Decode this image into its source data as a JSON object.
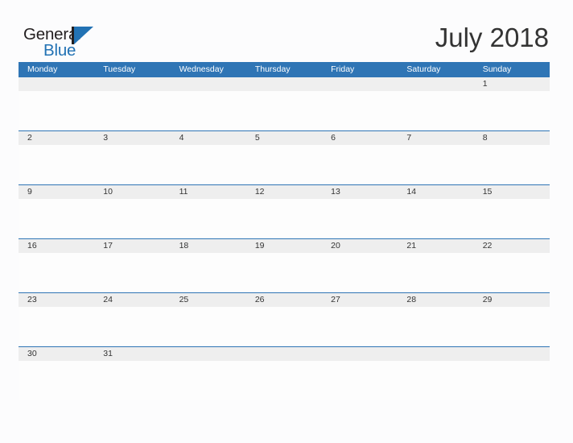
{
  "brand": {
    "name_top": "General",
    "name_bottom": "Blue",
    "mark_icon": "blue-triangle-flag-icon",
    "accent_color": "#2272b4",
    "dark_color": "#231f20"
  },
  "header": {
    "title": "July 2018"
  },
  "calendar": {
    "header_background": "#2f75b5",
    "row_line_color": "#2f75b5",
    "date_band_color": "#eeeeee",
    "weekday_labels": [
      "Monday",
      "Tuesday",
      "Wednesday",
      "Thursday",
      "Friday",
      "Saturday",
      "Sunday"
    ],
    "weeks": [
      {
        "days": [
          "",
          "",
          "",
          "",
          "",
          "",
          "1"
        ]
      },
      {
        "days": [
          "2",
          "3",
          "4",
          "5",
          "6",
          "7",
          "8"
        ]
      },
      {
        "days": [
          "9",
          "10",
          "11",
          "12",
          "13",
          "14",
          "15"
        ]
      },
      {
        "days": [
          "16",
          "17",
          "18",
          "19",
          "20",
          "21",
          "22"
        ]
      },
      {
        "days": [
          "23",
          "24",
          "25",
          "26",
          "27",
          "28",
          "29"
        ]
      },
      {
        "days": [
          "30",
          "31",
          "",
          "",
          "",
          "",
          ""
        ]
      }
    ]
  }
}
